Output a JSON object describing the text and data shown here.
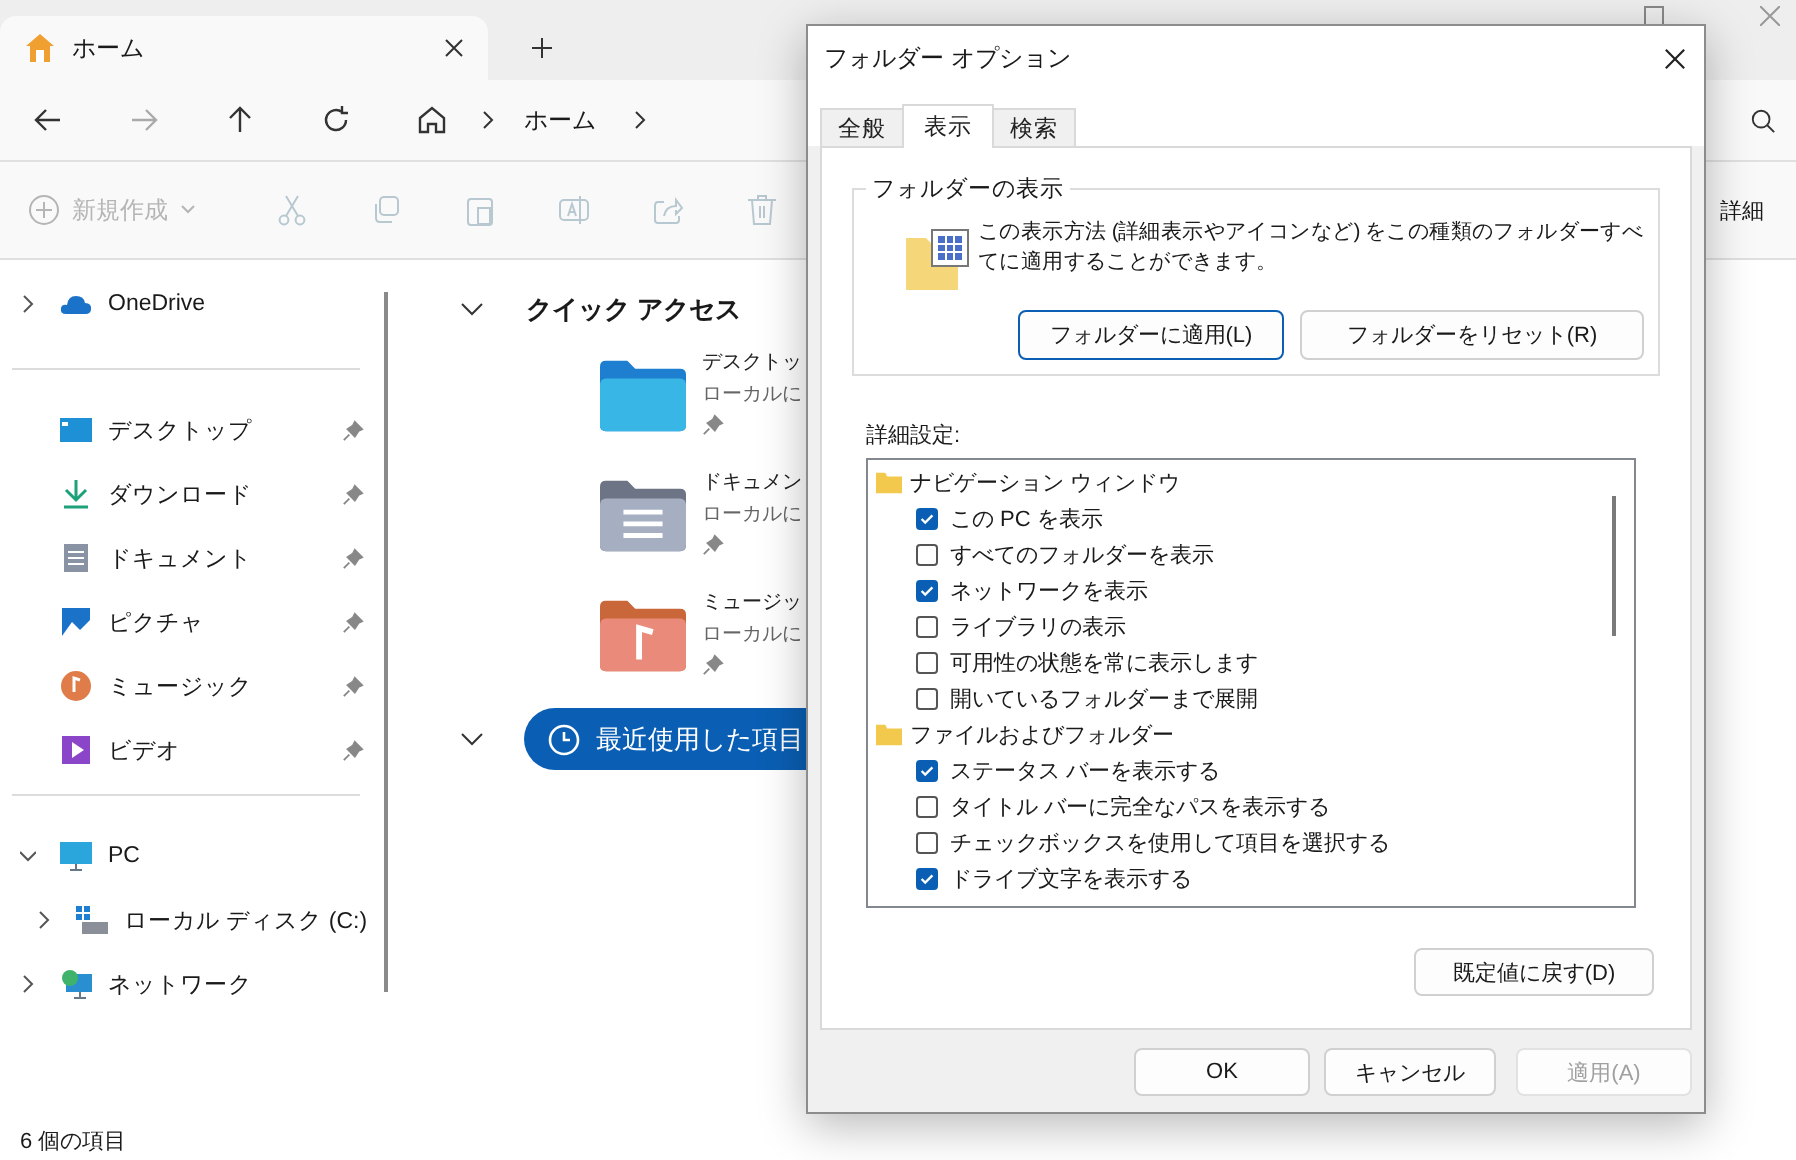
{
  "explorer": {
    "tab": {
      "title": "ホーム"
    },
    "breadcrumb": [
      "ホーム"
    ],
    "new_button": {
      "label": "新規作成",
      "disabled": true
    },
    "details_button": "詳細",
    "sidebar": {
      "top": [
        {
          "label": "OneDrive",
          "expanded": false
        }
      ],
      "pinned": [
        {
          "label": "デスクトップ",
          "pinned": true
        },
        {
          "label": "ダウンロード",
          "pinned": true
        },
        {
          "label": "ドキュメント",
          "pinned": true
        },
        {
          "label": "ピクチャ",
          "pinned": true
        },
        {
          "label": "ミュージック",
          "pinned": true
        },
        {
          "label": "ビデオ",
          "pinned": true
        }
      ],
      "tree": [
        {
          "label": "PC",
          "expanded": true,
          "children": [
            {
              "label": "ローカル ディスク (C:)",
              "expanded": false
            }
          ]
        },
        {
          "label": "ネットワーク",
          "expanded": false
        }
      ]
    },
    "quick_access": {
      "title": "クイック アクセス",
      "expanded": true,
      "items": [
        {
          "name": "デスクトッ",
          "location": "ローカルに",
          "pinned": true
        },
        {
          "name": "ドキュメン",
          "location": "ローカルに",
          "pinned": true
        },
        {
          "name": "ミュージッ",
          "location": "ローカルに",
          "pinned": true
        }
      ]
    },
    "recent": {
      "label": "最近使用した項目",
      "expanded": true
    },
    "status_bar": "6 個の項目"
  },
  "dialog": {
    "title": "フォルダー オプション",
    "tabs": [
      {
        "label": "全般",
        "selected": false
      },
      {
        "label": "表示",
        "selected": true
      },
      {
        "label": "検索",
        "selected": false
      }
    ],
    "folder_views": {
      "legend": "フォルダーの表示",
      "description": "この表示方法 (詳細表示やアイコンなど) をこの種類のフォルダーすべてに適用することができます。",
      "buttons": [
        {
          "label": "フォルダーに適用(L)",
          "focused": true
        },
        {
          "label": "フォルダーをリセット(R)",
          "focused": false
        }
      ]
    },
    "advanced_label": "詳細設定:",
    "settings": [
      {
        "kind": "group",
        "label": "ナビゲーション ウィンドウ"
      },
      {
        "kind": "checkbox",
        "label": "この PC を表示",
        "checked": true
      },
      {
        "kind": "checkbox",
        "label": "すべてのフォルダーを表示",
        "checked": false
      },
      {
        "kind": "checkbox",
        "label": "ネットワークを表示",
        "checked": true
      },
      {
        "kind": "checkbox",
        "label": "ライブラリの表示",
        "checked": false
      },
      {
        "kind": "checkbox",
        "label": "可用性の状態を常に表示します",
        "checked": false
      },
      {
        "kind": "checkbox",
        "label": "開いているフォルダーまで展開",
        "checked": false
      },
      {
        "kind": "group",
        "label": "ファイルおよびフォルダー"
      },
      {
        "kind": "checkbox",
        "label": "ステータス バーを表示する",
        "checked": true
      },
      {
        "kind": "checkbox",
        "label": "タイトル バーに完全なパスを表示する",
        "checked": false
      },
      {
        "kind": "checkbox",
        "label": "チェックボックスを使用して項目を選択する",
        "checked": false
      },
      {
        "kind": "checkbox",
        "label": "ドライブ文字を表示する",
        "checked": true
      }
    ],
    "restore_button": "既定値に戻す(D)",
    "buttons": [
      {
        "label": "OK",
        "disabled": false
      },
      {
        "label": "キャンセル",
        "disabled": false
      },
      {
        "label": "適用(A)",
        "disabled": true
      }
    ]
  }
}
